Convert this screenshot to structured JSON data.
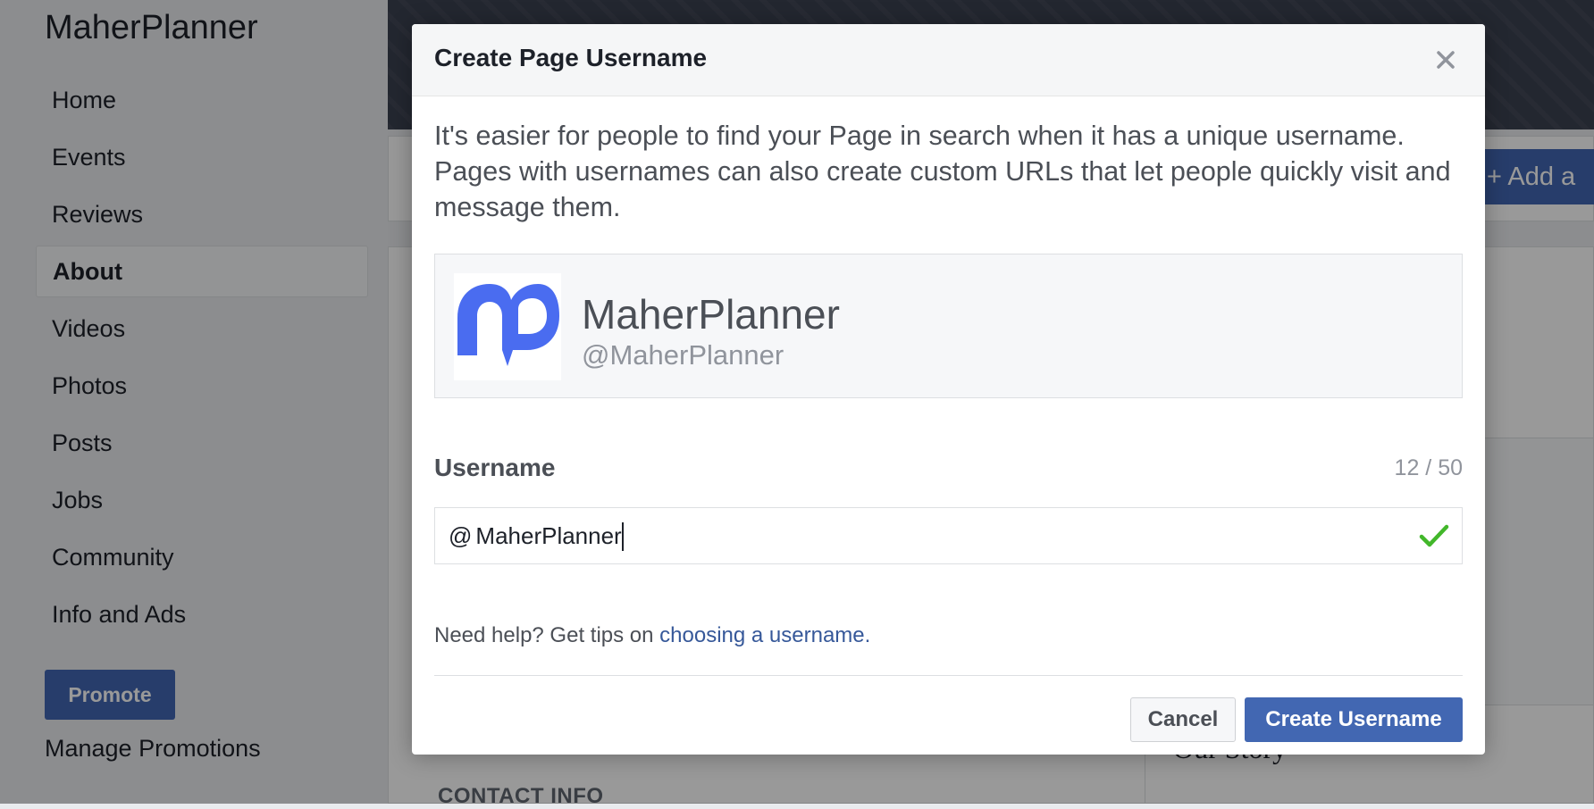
{
  "sidebar": {
    "page_name": "MaherPlanner",
    "items": [
      {
        "label": "Home"
      },
      {
        "label": "Events"
      },
      {
        "label": "Reviews"
      },
      {
        "label": "About"
      },
      {
        "label": "Videos"
      },
      {
        "label": "Photos"
      },
      {
        "label": "Posts"
      },
      {
        "label": "Jobs"
      },
      {
        "label": "Community"
      },
      {
        "label": "Info and Ads"
      }
    ],
    "active_item": "About",
    "promote_label": "Promote",
    "manage_promotions_label": "Manage Promotions"
  },
  "background": {
    "add_button_label": "+ Add a",
    "contact_info_label": "CONTACT INFO",
    "our_story_label": "Our Story"
  },
  "modal": {
    "title": "Create Page Username",
    "close_icon": "close-icon",
    "intro_text": "It's easier for people to find your Page in search when it has a unique username. Pages with usernames can also create custom URLs that let people quickly visit and message them.",
    "preview": {
      "name": "MaherPlanner",
      "handle": "@MaherPlanner",
      "logo_color": "#4a6cf0"
    },
    "field": {
      "label": "Username",
      "count": "12 / 50",
      "prefix": "@",
      "value": "MaherPlanner",
      "valid_icon": "checkmark-icon",
      "valid_color": "#42b72a"
    },
    "help_text": "Need help? Get tips on",
    "help_link": "choosing a username.",
    "cancel_label": "Cancel",
    "create_label": "Create Username"
  },
  "colors": {
    "primary": "#4267b2",
    "link": "#365899",
    "overlay": "rgba(0,0,0,0.4)"
  }
}
